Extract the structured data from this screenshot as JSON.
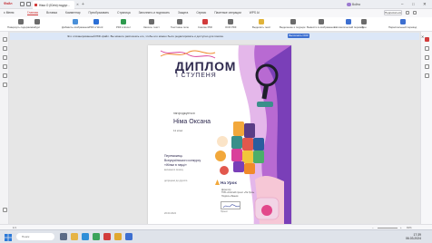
{
  "window": {
    "file_label": "Файл",
    "tab_title": "Німа О (Юлія) подруг...",
    "user_name": "Войта",
    "controls": {
      "minimize": "–",
      "maximize": "□",
      "close": "✕"
    }
  },
  "menu": {
    "menu_button": "≡ Меню",
    "items": [
      "Главная",
      "Вставка",
      "Комментар",
      "Преобразовать",
      "Страница",
      "Заполнить и подписать",
      "Защита",
      "Сервис",
      "Пакетные операции",
      "WPS AI"
    ],
    "active_index": 0,
    "sign_button": "Подписаться"
  },
  "toolbar": {
    "tools": [
      {
        "label": "Повернуть содержимое",
        "icon": "rotate-icon",
        "color": "#6b6b6b"
      },
      {
        "label": "Курс",
        "icon": "cursor-icon",
        "color": "#6b6b6b"
      },
      {
        "label": "Добавить изображение",
        "icon": "image-icon",
        "color": "#4a90d9"
      },
      {
        "label": "PDF в Word",
        "icon": "word-icon",
        "color": "#2b6fd6"
      },
      {
        "label": "PDF в Excel",
        "icon": "excel-icon",
        "color": "#2e9a4e"
      },
      {
        "label": "Заполн. текст",
        "icon": "text-icon",
        "color": "#6b6b6b"
      },
      {
        "label": "Текстовое поле",
        "icon": "textbox-icon",
        "color": "#6b6b6b"
      },
      {
        "label": "Сжатие PDF",
        "icon": "compress-icon",
        "color": "#d23c3c"
      },
      {
        "label": "OCR PDF",
        "icon": "ocr-icon",
        "color": "#6b6b6b"
      },
      {
        "label": "Выделить текст",
        "icon": "highlight-icon",
        "color": "#e0b33a"
      },
      {
        "label": "Выделение и подчерк.",
        "icon": "underline-icon",
        "color": "#6b6b6b"
      },
      {
        "label": "Вывести в изображение",
        "icon": "export-image-icon",
        "color": "#6b6b6b"
      },
      {
        "label": "Автоматический перевод",
        "icon": "translate-icon",
        "color": "#3d6fd0"
      },
      {
        "label": "Фон",
        "icon": "background-icon",
        "color": "#6b6b6b"
      },
      {
        "label": "Параллельный перевод",
        "icon": "parallel-translate-icon",
        "color": "#3d6fd0"
      }
    ]
  },
  "notice": {
    "text": "Это отсканированный PDF-файл. Вы можете распознать его, чтобы его можно было редактировать и доступно для поиска.",
    "button": "Выполнить OCR",
    "close": "✕"
  },
  "certificate": {
    "title": "ДИПЛОМ",
    "subtitle": "І СТУПЕНЯ",
    "awarded_label": "нагороджується",
    "name": "Німа Оксана",
    "class": "11 клас",
    "event_line1": "Переможець",
    "event_line2": "Всеукраїнського конкурсу",
    "event_line3": "«Жінки в науці»",
    "event_line4": "весняного сезону",
    "extra_line": "допущено до другого",
    "logo_text": "На Урок",
    "sign_line1": "Директор",
    "sign_line2": "ТОВ «Освітній проект «На Урок»",
    "sign_line3": "Подпись Иванов",
    "sign_label": "Проект",
    "date": "20.03.2024"
  },
  "status": {
    "page": "1/1",
    "zoom": "91%",
    "zoom_minus": "–",
    "zoom_plus": "+"
  },
  "taskbar": {
    "search_placeholder": "Поиск",
    "time": "17:39",
    "date": "06.03.2024",
    "apps": [
      {
        "name": "task-view-icon",
        "color": "#5b6b86"
      },
      {
        "name": "file-explorer-icon",
        "color": "#e6b446"
      },
      {
        "name": "browser-icon",
        "color": "#2f8fd8"
      },
      {
        "name": "chrome-icon",
        "color": "#3aa35a"
      },
      {
        "name": "wps-pdf-icon",
        "color": "#d23c3c"
      },
      {
        "name": "folder-icon",
        "color": "#e0a830"
      },
      {
        "name": "mail-icon",
        "color": "#3d6fd0"
      }
    ]
  }
}
